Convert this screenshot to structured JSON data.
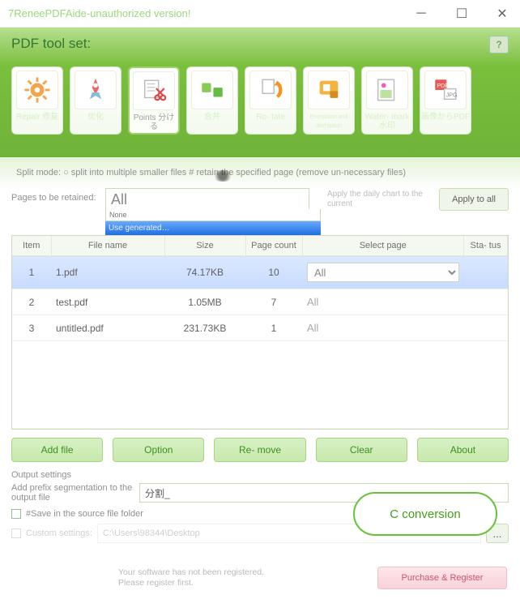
{
  "window": {
    "title": "7ReneePDFAide-unauthorized version!"
  },
  "header": {
    "title": "PDF tool set:",
    "help_icon": "?"
  },
  "tools": [
    {
      "name": "repair",
      "label": "Repair\n修复"
    },
    {
      "name": "optimize",
      "label": "优化"
    },
    {
      "name": "points",
      "label": "Points\n分ける",
      "selected": true
    },
    {
      "name": "merge",
      "label": "合并"
    },
    {
      "name": "rotate",
      "label": "Ro-\ntate"
    },
    {
      "name": "encrypt",
      "label": "Encryption and decryption"
    },
    {
      "name": "watermark",
      "label": "Water-\nmark\n水印"
    },
    {
      "name": "imgtopdf",
      "label": "画像からPDF"
    }
  ],
  "split": {
    "mode_text": "Split mode: ○ split into multiple smaller files # retain the specified page (remove un-necessary files)",
    "pages_label": "Pages to be retained:",
    "pages_value": "All",
    "dropdown_opt1": "None",
    "dropdown_opt2": "Use generated…",
    "apply_hint": "Apply the daily chart to the current",
    "apply_all": "Apply to all"
  },
  "table": {
    "headers": {
      "item": "Item",
      "filename": "File\nname",
      "size": "Size",
      "pagecount": "Page\ncount",
      "selectpage": "Select page",
      "status": "Sta-\ntus"
    },
    "rows": [
      {
        "item": "1",
        "name": "1.pdf",
        "size": "74.17KB",
        "pages": "10",
        "select": "All",
        "status": "",
        "selected": true
      },
      {
        "item": "2",
        "name": "test.pdf",
        "size": "1.05MB",
        "pages": "7",
        "select": "All",
        "status": ""
      },
      {
        "item": "3",
        "name": "untitled.pdf",
        "size": "231.73KB",
        "pages": "1",
        "select": "All",
        "status": ""
      }
    ]
  },
  "buttons": {
    "add": "Add file",
    "option": "Option",
    "remove": "Re-\nmove",
    "clear": "Clear",
    "about": "About"
  },
  "output": {
    "title": "Output settings",
    "prefix_label": "Add prefix segmentation to the output file",
    "prefix_value": "分割_",
    "save_src": "#Save in the source file folder",
    "custom_label": "Custom settings:",
    "custom_value": "C:\\Users\\98344\\Desktop",
    "browse": "..."
  },
  "convert": {
    "label": "C conversion"
  },
  "footer": {
    "msg1": "Your software has not been registered.",
    "msg2": "Please register first.",
    "register": "Purchase &\nRegister"
  }
}
